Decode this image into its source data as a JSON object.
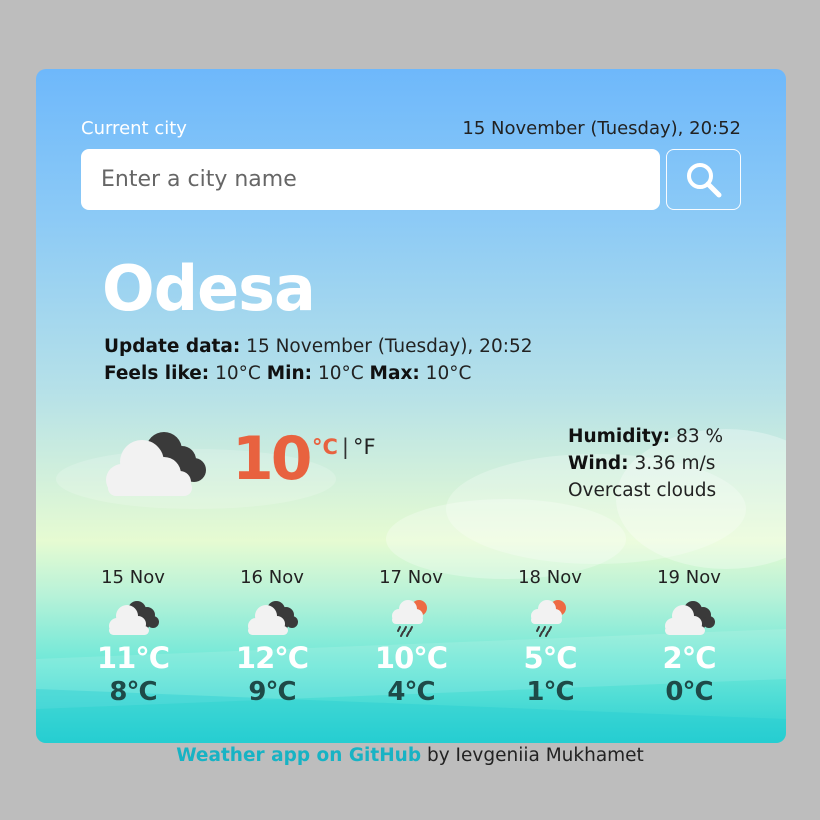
{
  "header": {
    "current_city_label": "Current city",
    "current_date": "15 November (Tuesday), 20:52"
  },
  "search": {
    "placeholder": "Enter a city name",
    "value": "",
    "button_icon": "search-icon"
  },
  "current": {
    "city": "Odesa",
    "update_label": "Update data:",
    "update_value": "15 November (Tuesday), 20:52",
    "feels_label": "Feels like:",
    "feels_value": "10°C",
    "min_label": "Min:",
    "min_value": "10°C",
    "max_label": "Max:",
    "max_value": "10°C",
    "icon": "cloudy-icon",
    "temperature": "10",
    "unit_c": "°C",
    "unit_sep": "|",
    "unit_f": "°F",
    "humidity_label": "Humidity:",
    "humidity_value": "83 %",
    "wind_label": "Wind:",
    "wind_value": "3.36 m/s",
    "description": "Overcast clouds"
  },
  "forecast": [
    {
      "date": "15 Nov",
      "icon": "cloudy-icon",
      "max": "11°C",
      "min": "8°C"
    },
    {
      "date": "16 Nov",
      "icon": "cloudy-icon",
      "max": "12°C",
      "min": "9°C"
    },
    {
      "date": "17 Nov",
      "icon": "rain-icon",
      "max": "10°C",
      "min": "4°C"
    },
    {
      "date": "18 Nov",
      "icon": "rain-icon",
      "max": "5°C",
      "min": "1°C"
    },
    {
      "date": "19 Nov",
      "icon": "cloudy-icon",
      "max": "2°C",
      "min": "0°C"
    }
  ],
  "footer": {
    "link_text": "Weather app on GitHub",
    "author_text": "by Ievgeniia Mukhamet"
  },
  "colors": {
    "accent": "#e8623f",
    "link": "#17b3c4",
    "min_temp": "#1e4a48"
  }
}
